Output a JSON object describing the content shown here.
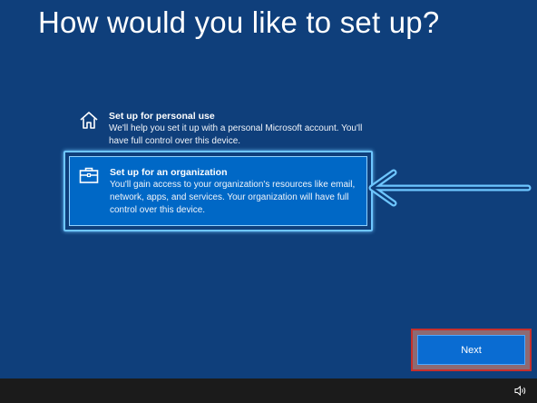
{
  "header": {
    "title": "How would you like to set up?"
  },
  "options": [
    {
      "label": "Set up for personal use",
      "description": "We'll help you set it up with a personal Microsoft account. You'll have full control over this device.",
      "icon": "home-icon",
      "selected": false
    },
    {
      "label": "Set up for an organization",
      "description": "You'll gain access to your organization's resources like email, network, apps, and services. Your organization will have full control over this device.",
      "icon": "briefcase-icon",
      "selected": true
    }
  ],
  "footer": {
    "next_label": "Next"
  },
  "taskbar": {
    "icon": "volume-icon"
  },
  "colors": {
    "background": "#0f3f7b",
    "selected_option": "#0068c6",
    "highlight": "#6ec6ff",
    "next_button": "#0a6cd2",
    "next_highlight": "#c6302c",
    "taskbar": "#1b1b1b"
  }
}
